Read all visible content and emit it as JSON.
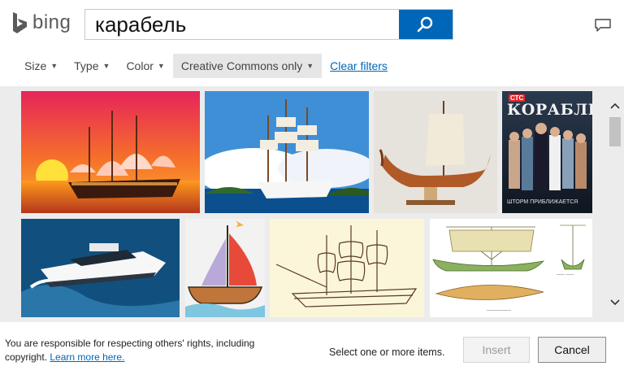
{
  "brand": {
    "name": "bing",
    "color": "#0067b8"
  },
  "search": {
    "query": "карабель"
  },
  "icons": {
    "search": "search-icon",
    "feedback": "feedback-icon"
  },
  "filters": [
    {
      "label": "Size",
      "active": false
    },
    {
      "label": "Type",
      "active": false
    },
    {
      "label": "Color",
      "active": false
    },
    {
      "label": "Creative Commons only",
      "active": true
    }
  ],
  "clear_filters": "Clear filters",
  "results": [
    {
      "name": "result-sailing-ship-sunset",
      "badge": ""
    },
    {
      "name": "result-tall-ship-sea",
      "badge": ""
    },
    {
      "name": "result-viking-ship-model",
      "badge": ""
    },
    {
      "name": "result-korabl-poster",
      "badge": "СТС",
      "title": "КОРАБЛЬ",
      "subtitle": "ШТОРМ ПРИБЛИЖАЕТСЯ"
    },
    {
      "name": "result-motor-yacht",
      "badge": ""
    },
    {
      "name": "result-cartoon-sailboat",
      "badge": ""
    },
    {
      "name": "result-ship-sketch",
      "badge": ""
    },
    {
      "name": "result-ancient-ship-drawing",
      "badge": ""
    }
  ],
  "footer": {
    "notice_text": "You are responsible for respecting others' rights, including copyright.",
    "learn_more": "Learn more here.",
    "select_hint": "Select one or more items.",
    "insert_label": "Insert",
    "cancel_label": "Cancel"
  }
}
